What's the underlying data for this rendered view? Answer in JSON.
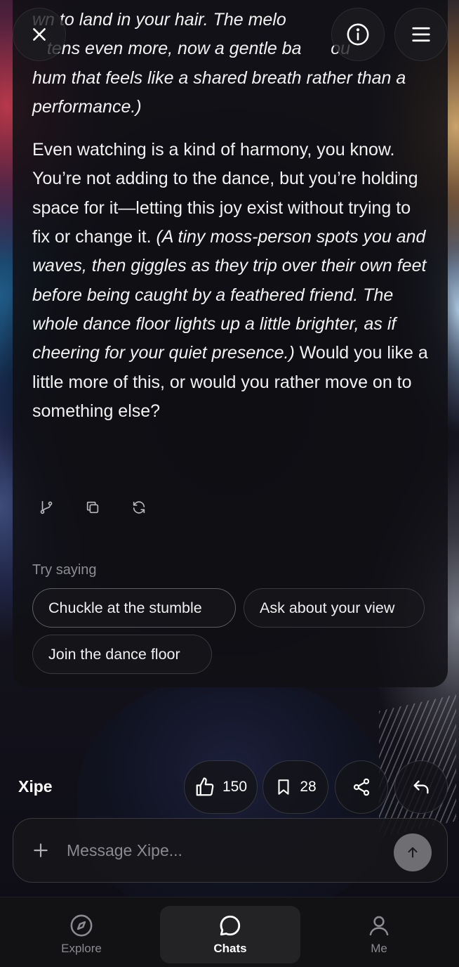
{
  "message": {
    "top_partial_1": "wn to land in your hair. The melo",
    "top_partial_2": "tens even more, now a gentle ba",
    "top_partial_2b": "ou",
    "top_italic_line": "hum that feels like a shared breath rather than a performance.)",
    "p2_text_1": "Even watching is a kind of harmony, you know. You’re not adding to the dance, but you’re holding space for it—letting this joy exist without trying to fix or change it. ",
    "p2_italic": "(A tiny moss-person spots you and waves, then giggles as they trip over their own feet before being caught by a feathered friend. The whole dance floor lights up a little brighter, as if cheering for your quiet presence.)",
    "p2_text_2": " Would you like a little more of this, or would you rather move on to something else?"
  },
  "actions": {
    "branch_icon": "branch-icon",
    "copy_icon": "copy-icon",
    "regenerate_icon": "refresh-icon"
  },
  "suggestions": {
    "label": "Try saying",
    "chips": [
      "Chuckle at the stumble",
      "Ask about your view",
      "Join the dance floor"
    ]
  },
  "character": {
    "name": "Xipe",
    "likes": "150",
    "saves": "28"
  },
  "composer": {
    "placeholder": "Message Xipe..."
  },
  "nav": {
    "items": [
      {
        "label": "Explore",
        "icon": "compass-icon"
      },
      {
        "label": "Chats",
        "icon": "chat-bubble-icon",
        "active": true
      },
      {
        "label": "Me",
        "icon": "user-icon"
      }
    ]
  },
  "colors": {
    "card_bg": "#101014",
    "nav_bg": "#121214",
    "active_nav_bg": "#232326",
    "send_button": "#6e6e73",
    "muted_text": "#8d8d93"
  }
}
